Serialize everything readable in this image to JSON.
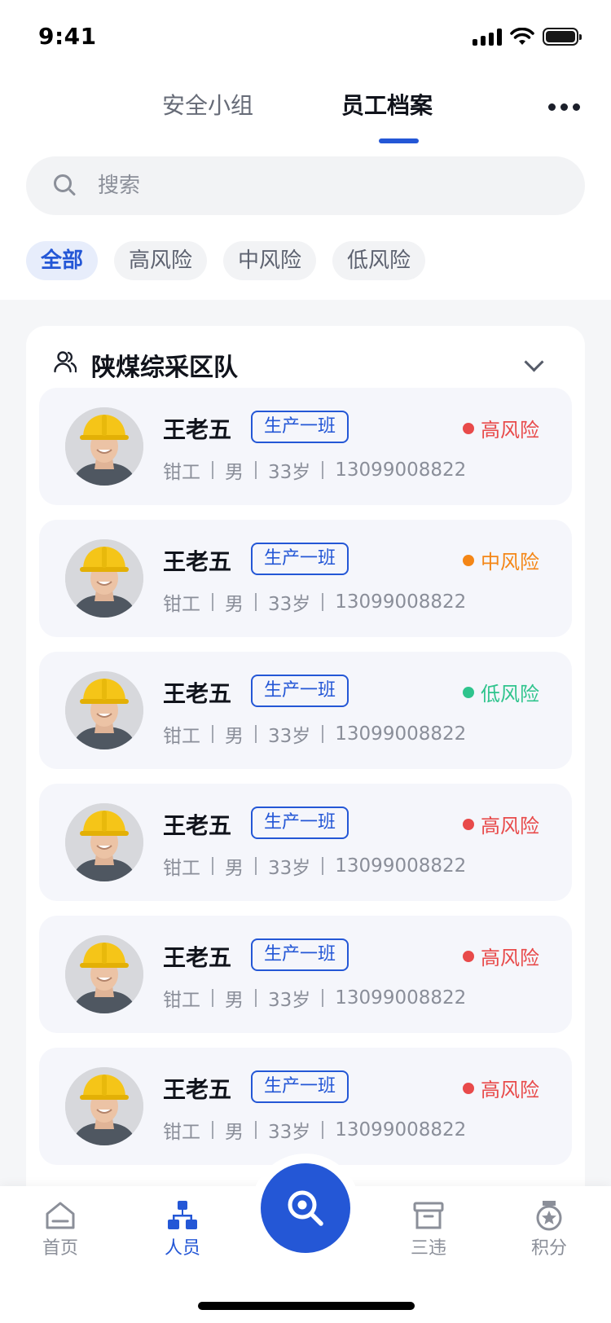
{
  "status_bar": {
    "time": "9:41"
  },
  "header": {
    "tabs": [
      {
        "label": "安全小组",
        "active": false
      },
      {
        "label": "员工档案",
        "active": true
      }
    ]
  },
  "search": {
    "placeholder": "搜索",
    "value": ""
  },
  "filters": [
    {
      "label": "全部",
      "active": true
    },
    {
      "label": "高风险",
      "active": false
    },
    {
      "label": "中风险",
      "active": false
    },
    {
      "label": "低风险",
      "active": false
    }
  ],
  "group": {
    "title": "陕煤综采区队",
    "employees": [
      {
        "name": "王老五",
        "team": "生产一班",
        "risk": "高风险",
        "risk_level": "high",
        "job": "钳工",
        "gender": "男",
        "age": "33岁",
        "phone": "13099008822"
      },
      {
        "name": "王老五",
        "team": "生产一班",
        "risk": "中风险",
        "risk_level": "mid",
        "job": "钳工",
        "gender": "男",
        "age": "33岁",
        "phone": "13099008822"
      },
      {
        "name": "王老五",
        "team": "生产一班",
        "risk": "低风险",
        "risk_level": "low",
        "job": "钳工",
        "gender": "男",
        "age": "33岁",
        "phone": "13099008822"
      },
      {
        "name": "王老五",
        "team": "生产一班",
        "risk": "高风险",
        "risk_level": "high",
        "job": "钳工",
        "gender": "男",
        "age": "33岁",
        "phone": "13099008822"
      },
      {
        "name": "王老五",
        "team": "生产一班",
        "risk": "高风险",
        "risk_level": "high",
        "job": "钳工",
        "gender": "男",
        "age": "33岁",
        "phone": "13099008822"
      },
      {
        "name": "王老五",
        "team": "生产一班",
        "risk": "高风险",
        "risk_level": "high",
        "job": "钳工",
        "gender": "男",
        "age": "33岁",
        "phone": "13099008822"
      }
    ]
  },
  "tabbar": {
    "items": [
      {
        "label": "首页",
        "icon": "home-icon",
        "active": false
      },
      {
        "label": "人员",
        "icon": "org-chart-icon",
        "active": true
      },
      {
        "label": "三违",
        "icon": "archive-box-icon",
        "active": false
      },
      {
        "label": "积分",
        "icon": "medal-icon",
        "active": false
      }
    ],
    "center_icon": "scan-search-icon"
  },
  "colors": {
    "accent": "#2457d6",
    "risk_high": "#e84a4a",
    "risk_mid": "#f48616",
    "risk_low": "#2fc48d"
  }
}
